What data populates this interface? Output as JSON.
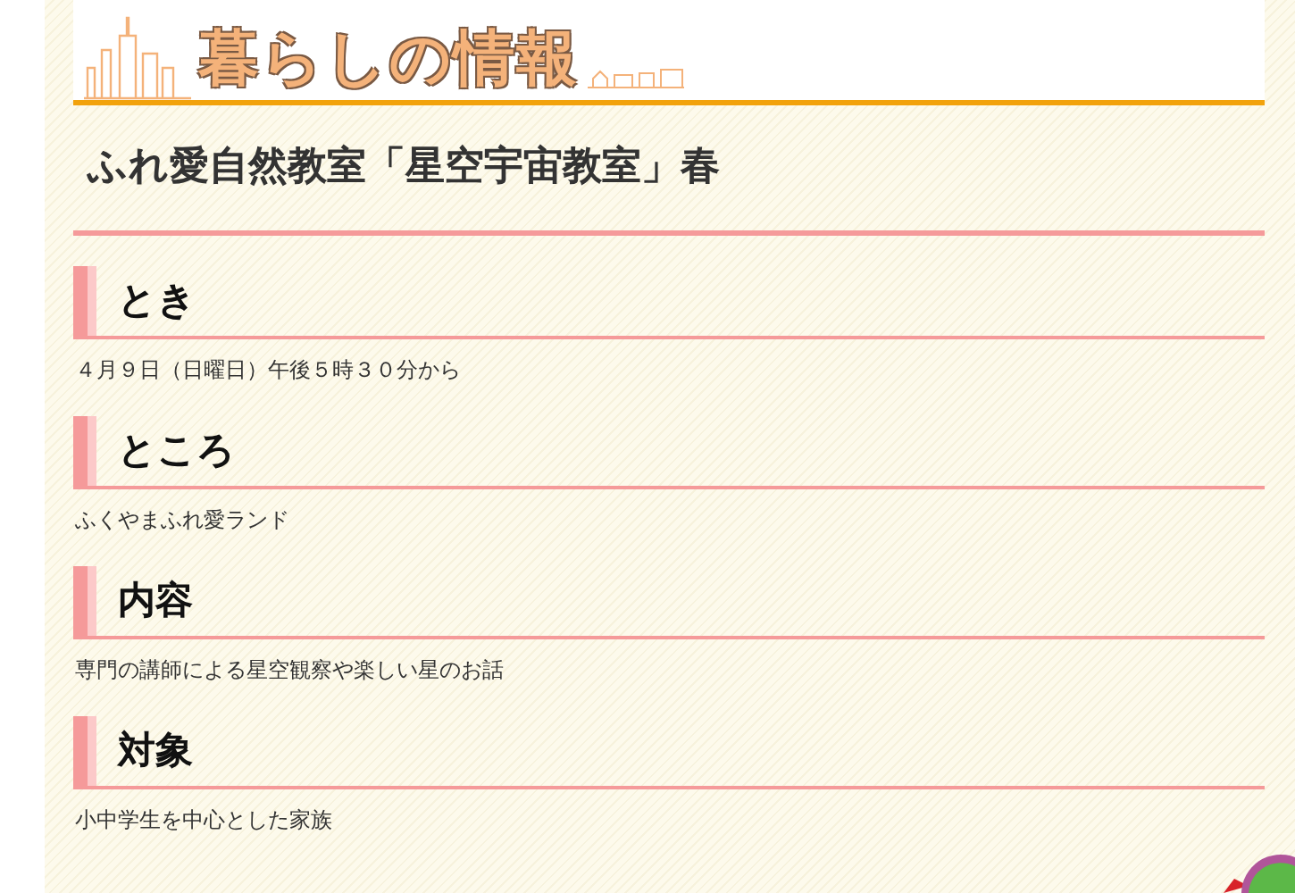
{
  "banner": {
    "title": "暮らしの情報"
  },
  "page_title": "ふれ愛自然教室「星空宇宙教室」春",
  "sections": [
    {
      "heading": "とき",
      "text": "４月９日（日曜日）午後５時３０分から"
    },
    {
      "heading": "ところ",
      "text": "ふくやまふれ愛ランド"
    },
    {
      "heading": "内容",
      "text": "専門の講師による星空観察や楽しい星のお話"
    },
    {
      "heading": "対象",
      "text": "小中学生を中心とした家族"
    }
  ]
}
